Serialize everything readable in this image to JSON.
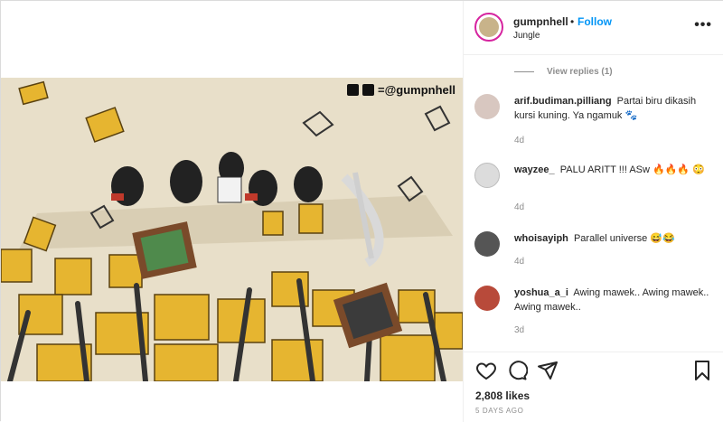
{
  "post": {
    "owner": "gumpnhell",
    "separator": "•",
    "follow_label": "Follow",
    "location": "Jungle",
    "more_label": "•••"
  },
  "image": {
    "handle_text": "=@gumpnhell"
  },
  "comments": {
    "view_replies": "View replies (1)",
    "items": [
      {
        "user": "arif.budiman.pilliang",
        "text": "Partai biru dikasih kursi kuning. Ya ngamuk 🐾",
        "time": "4d"
      },
      {
        "user": "wayzee_",
        "text": "PALU ARITT !!! ASw 🔥🔥🔥 😳",
        "time": "4d"
      },
      {
        "user": "whoisayiph",
        "text": "Parallel universe 😅😂",
        "time": "4d"
      },
      {
        "user": "yoshua_a_i",
        "text": "Awing mawek.. Awing mawek.. Awing mawek..",
        "time": "3d"
      }
    ]
  },
  "actions": {
    "likes": "2,808 likes",
    "date": "5 DAYS AGO"
  },
  "colors": {
    "accent": "#0095f6",
    "muted": "#8e8e8e",
    "border": "#dbdbdb",
    "chair_yellow": "#e6b530"
  }
}
